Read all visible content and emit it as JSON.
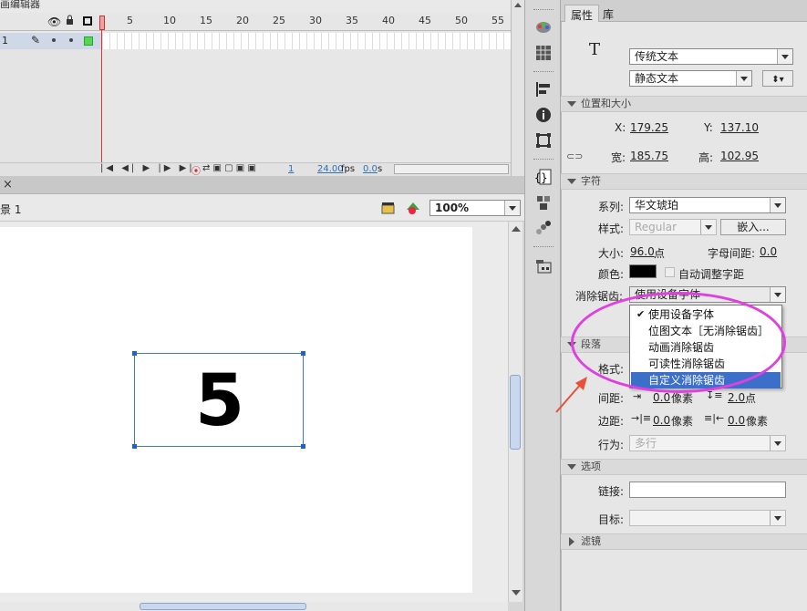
{
  "timeline": {
    "title": "画编辑器",
    "layer_name": "1",
    "frame_numbers": [
      "1",
      "5",
      "10",
      "15",
      "20",
      "25",
      "30",
      "35",
      "40",
      "45",
      "50",
      "55"
    ],
    "fps": "24.00",
    "fps_unit": "fps",
    "current_frame": "1",
    "elapsed": "0.0",
    "elapsed_unit": "s"
  },
  "stage": {
    "close_glyph": "×",
    "scene_label": "景 1",
    "zoom": "100%",
    "text_content": "5"
  },
  "props": {
    "tab_properties": "属性",
    "tab_library": "库",
    "type_icon": "T",
    "text_engine": "传统文本",
    "text_type": "静态文本",
    "section_position": "位置和大小",
    "x_label": "X:",
    "x_value": "179.25",
    "y_label": "Y:",
    "y_value": "137.10",
    "w_label": "宽:",
    "w_value": "185.75",
    "h_label": "高:",
    "h_value": "102.95",
    "section_char": "字符",
    "family_label": "系列:",
    "family_value": "华文琥珀",
    "style_label": "样式:",
    "style_value": "Regular",
    "embed_button": "嵌入...",
    "size_label": "大小:",
    "size_value": "96.0",
    "size_unit": "点",
    "spacing_label": "字母间距:",
    "spacing_value": "0.0",
    "color_label": "颜色:",
    "color_value": "#000000",
    "autokern_label": "自动调整字距",
    "aa_label": "消除锯齿:",
    "aa_value": "使用设备字体",
    "section_para": "段落",
    "format_label": "格式:",
    "spacing2_label": "间距:",
    "indent_value": "0.0",
    "pixel_unit": "像素",
    "line_value": "2.0",
    "point_unit": "点",
    "margin_label": "边距:",
    "margin_left": "0.0",
    "margin_right": "0.0",
    "behavior_label": "行为:",
    "behavior_value": "多行",
    "section_options": "选项",
    "link_label": "链接:",
    "target_label": "目标:",
    "section_filters": "滤镜"
  },
  "dropdown": {
    "items": [
      "使用设备字体",
      "位图文本［无消除锯齿］",
      "动画消除锯齿",
      "可读性消除锯齿",
      "自定义消除锯齿"
    ],
    "checked_index": 0,
    "highlighted_index": 4,
    "check_glyph": "✔"
  },
  "colors": {
    "highlight": "#3b6fc9",
    "annotation_ellipse": "#e040e0",
    "annotation_arrow": "#e8503a",
    "link_blue": "#2f6fb5"
  }
}
